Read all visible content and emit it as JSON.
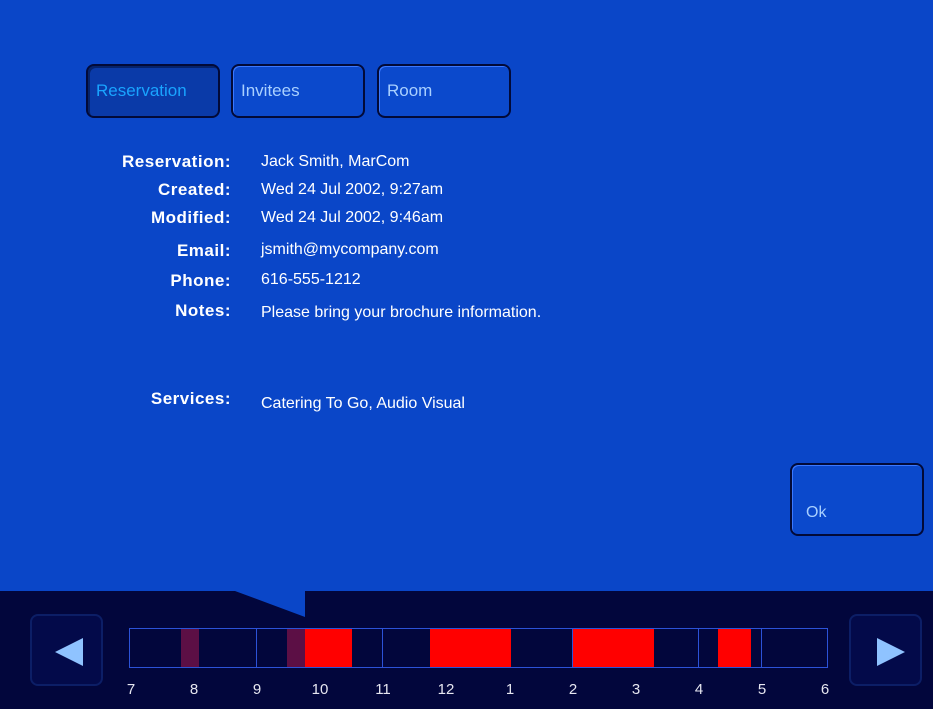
{
  "tabs": [
    {
      "label": "Reservation",
      "active": true
    },
    {
      "label": "Invitees",
      "active": false
    },
    {
      "label": "Room",
      "active": false
    }
  ],
  "details": {
    "reservation": {
      "label": "Reservation:",
      "value": "Jack Smith, MarCom"
    },
    "created": {
      "label": "Created:",
      "value": "Wed 24 Jul 2002, 9:27am"
    },
    "modified": {
      "label": "Modified:",
      "value": "Wed 24 Jul 2002, 9:46am"
    },
    "email": {
      "label": "Email:",
      "value": "jsmith@mycompany.com"
    },
    "phone": {
      "label": "Phone:",
      "value": "616-555-1212"
    },
    "notes": {
      "label": "Notes:",
      "value": "Please bring your brochure information."
    },
    "services": {
      "label": "Services:",
      "value": "Catering To Go, Audio Visual"
    }
  },
  "ok_label": "Ok",
  "timeline": {
    "hours": [
      "7",
      "8",
      "9",
      "10",
      "11",
      "12",
      "1",
      "2",
      "3",
      "4",
      "5",
      "6"
    ],
    "icons": {
      "prev": "left-triangle-icon",
      "next": "right-triangle-icon"
    },
    "colors": {
      "booked": "#ff0000",
      "tentative": "#5c0f45",
      "free": "#02063c",
      "grid": "#2c52d8"
    }
  }
}
